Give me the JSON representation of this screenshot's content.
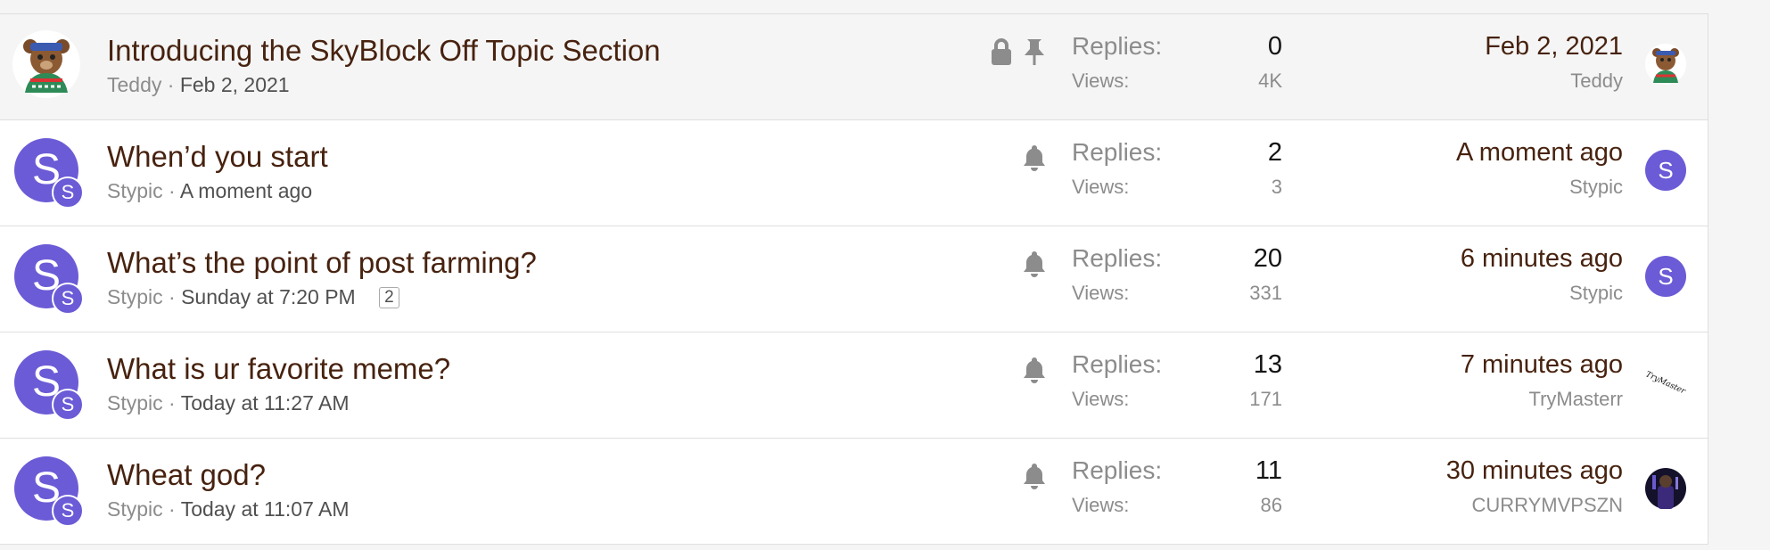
{
  "threads": [
    {
      "title": "Introducing the SkyBlock Off Topic Section",
      "author": "Teddy",
      "sep": "·",
      "date": "Feb 2, 2021",
      "replies_label": "Replies:",
      "replies": "0",
      "views_label": "Views:",
      "views": "4K",
      "last_time": "Feb 2, 2021",
      "last_user": "Teddy",
      "icons": [
        "lock-icon",
        "pin-icon"
      ]
    },
    {
      "title": "When’d you start",
      "author": "Stypic",
      "sep": "·",
      "date": "A moment ago",
      "avatar_letter": "S",
      "replies_label": "Replies:",
      "replies": "2",
      "views_label": "Views:",
      "views": "3",
      "last_time": "A moment ago",
      "last_user": "Stypic",
      "last_avatar_letter": "S",
      "icons": [
        "bell-icon"
      ]
    },
    {
      "title": "What’s the point of post farming?",
      "author": "Stypic",
      "sep": "·",
      "date": "Sunday at 7:20 PM",
      "page_link": "2",
      "avatar_letter": "S",
      "replies_label": "Replies:",
      "replies": "20",
      "views_label": "Views:",
      "views": "331",
      "last_time": "6 minutes ago",
      "last_user": "Stypic",
      "last_avatar_letter": "S",
      "icons": [
        "bell-icon"
      ]
    },
    {
      "title": "What is ur favorite meme?",
      "author": "Stypic",
      "sep": "·",
      "date": "Today at 11:27 AM",
      "avatar_letter": "S",
      "replies_label": "Replies:",
      "replies": "13",
      "views_label": "Views:",
      "views": "171",
      "last_time": "7 minutes ago",
      "last_user": "TryMasterr",
      "last_avatar_text": "TryMaster",
      "icons": [
        "bell-icon"
      ]
    },
    {
      "title": "Wheat god?",
      "author": "Stypic",
      "sep": "·",
      "date": "Today at 11:07 AM",
      "avatar_letter": "S",
      "replies_label": "Replies:",
      "replies": "11",
      "views_label": "Views:",
      "views": "86",
      "last_time": "30 minutes ago",
      "last_user": "CURRYMVPSZN",
      "icons": [
        "bell-icon"
      ]
    }
  ],
  "colors": {
    "title": "#47220f",
    "muted": "#8c8c8c",
    "avatar": "#6b5bd6",
    "sticky_bg": "#f5f5f5",
    "border": "#dfdfdf"
  }
}
